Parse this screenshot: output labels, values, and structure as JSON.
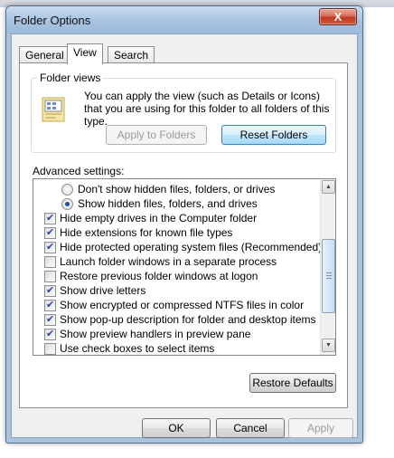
{
  "window": {
    "title": "Folder Options",
    "close_label": "X"
  },
  "tabs": [
    {
      "label": "General"
    },
    {
      "label": "View"
    },
    {
      "label": "Search"
    }
  ],
  "folder_views": {
    "group_label": "Folder views",
    "description": "You can apply the view (such as Details or Icons) that you are using for this folder to all folders of this type.",
    "apply_label": "Apply to Folders",
    "reset_label": "Reset Folders"
  },
  "advanced": {
    "label": "Advanced settings:",
    "items": [
      {
        "type": "radio",
        "checked": false,
        "label": "Don't show hidden files, folders, or drives"
      },
      {
        "type": "radio",
        "checked": true,
        "label": "Show hidden files, folders, and drives"
      },
      {
        "type": "checkbox",
        "checked": true,
        "label": "Hide empty drives in the Computer folder"
      },
      {
        "type": "checkbox",
        "checked": true,
        "label": "Hide extensions for known file types"
      },
      {
        "type": "checkbox",
        "checked": true,
        "label": "Hide protected operating system files (Recommended)"
      },
      {
        "type": "checkbox",
        "checked": false,
        "label": "Launch folder windows in a separate process"
      },
      {
        "type": "checkbox",
        "checked": false,
        "label": "Restore previous folder windows at logon"
      },
      {
        "type": "checkbox",
        "checked": true,
        "label": "Show drive letters"
      },
      {
        "type": "checkbox",
        "checked": true,
        "label": "Show encrypted or compressed NTFS files in color"
      },
      {
        "type": "checkbox",
        "checked": true,
        "label": "Show pop-up description for folder and desktop items"
      },
      {
        "type": "checkbox",
        "checked": true,
        "label": "Show preview handlers in preview pane"
      },
      {
        "type": "checkbox",
        "checked": false,
        "label": "Use check boxes to select items"
      }
    ],
    "restore_defaults_label": "Restore Defaults"
  },
  "footer": {
    "ok_label": "OK",
    "cancel_label": "Cancel",
    "apply_label": "Apply"
  }
}
